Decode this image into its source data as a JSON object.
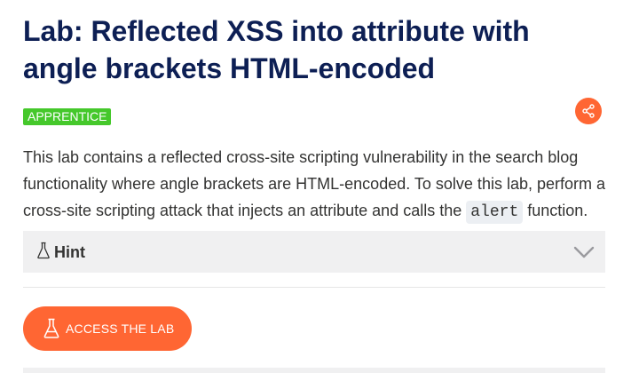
{
  "title": "Lab: Reflected XSS into attribute with angle brackets HTML-encoded",
  "level": "APPRENTICE",
  "share_icon": "share-icon",
  "description": {
    "text_before": "This lab contains a reflected cross-site scripting vulnerability in the search blog functionality where angle brackets are HTML-encoded. To solve this lab, perform a cross-site scripting attack that injects an attribute and calls the ",
    "code": "alert",
    "text_after": " function."
  },
  "hint": {
    "label": "Hint",
    "icon": "flask-icon",
    "toggle_icon": "chevron-down-icon"
  },
  "access_button": {
    "label": "ACCESS THE LAB",
    "icon": "flask-icon"
  },
  "colors": {
    "title": "#0d1f54",
    "accent": "#ff6633",
    "badge": "#45c82b",
    "hint_bg": "#f0f0f1"
  }
}
